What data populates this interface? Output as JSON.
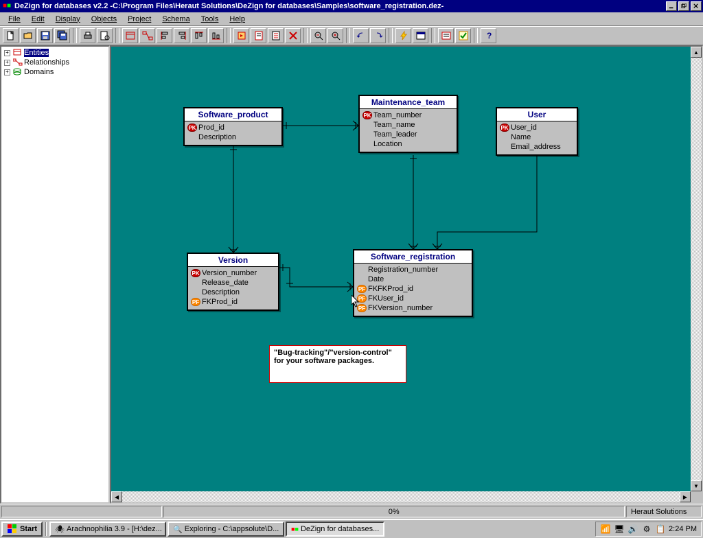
{
  "windowTitle": "DeZign for databases v2.2 -C:\\Program Files\\Heraut Solutions\\DeZign for databases\\Samples\\software_registration.dez-",
  "menus": [
    "File",
    "Edit",
    "Display",
    "Objects",
    "Project",
    "Schema",
    "Tools",
    "Help"
  ],
  "tree": {
    "items": [
      {
        "label": "Entities",
        "selected": true
      },
      {
        "label": "Relationships",
        "selected": false
      },
      {
        "label": "Domains",
        "selected": false
      }
    ]
  },
  "entities": {
    "software_product": {
      "title": "Software_product",
      "fields": [
        {
          "key": "pk",
          "keyLabel": "PK",
          "name": "Prod_id"
        },
        {
          "key": "none",
          "keyLabel": "",
          "name": "Description"
        }
      ]
    },
    "maintenance_team": {
      "title": "Maintenance_team",
      "fields": [
        {
          "key": "pk",
          "keyLabel": "PK",
          "name": "Team_number"
        },
        {
          "key": "none",
          "keyLabel": "",
          "name": "Team_name"
        },
        {
          "key": "none",
          "keyLabel": "",
          "name": "Team_leader"
        },
        {
          "key": "none",
          "keyLabel": "",
          "name": "Location"
        }
      ]
    },
    "user": {
      "title": "User",
      "fields": [
        {
          "key": "pk",
          "keyLabel": "PK",
          "name": "User_id"
        },
        {
          "key": "none",
          "keyLabel": "",
          "name": "Name"
        },
        {
          "key": "none",
          "keyLabel": "",
          "name": "Email_address"
        }
      ]
    },
    "version": {
      "title": "Version",
      "fields": [
        {
          "key": "pk",
          "keyLabel": "PK",
          "name": "Version_number"
        },
        {
          "key": "none",
          "keyLabel": "",
          "name": "Release_date"
        },
        {
          "key": "none",
          "keyLabel": "",
          "name": "Description"
        },
        {
          "key": "pf",
          "keyLabel": "PF",
          "name": "FKProd_id"
        }
      ]
    },
    "software_registration": {
      "title": "Software_registration",
      "fields": [
        {
          "key": "none",
          "keyLabel": "",
          "name": "Registration_number"
        },
        {
          "key": "none",
          "keyLabel": "",
          "name": "Date"
        },
        {
          "key": "pf",
          "keyLabel": "PF",
          "name": "FKFKProd_id"
        },
        {
          "key": "pf",
          "keyLabel": "PF",
          "name": "FKUser_id"
        },
        {
          "key": "pf",
          "keyLabel": "PF",
          "name": "FKVersion_number"
        }
      ]
    }
  },
  "note": "\"Bug-tracking\"/\"version-control\" for your software packages.",
  "status": {
    "progress": "0%",
    "company": "Heraut Solutions"
  },
  "taskbar": {
    "start": "Start",
    "tasks": [
      {
        "label": "Arachnophilia 3.9 - [H:\\dez...",
        "active": false
      },
      {
        "label": "Exploring - C:\\appsolute\\D...",
        "active": false
      },
      {
        "label": "DeZign for databases...",
        "active": true
      }
    ],
    "clock": "2:24 PM"
  },
  "chart_data": {
    "type": "diagram",
    "diagram_kind": "entity-relationship",
    "title": "software_registration",
    "entities": [
      {
        "name": "Software_product",
        "attributes": [
          {
            "name": "Prod_id",
            "key": "PK"
          },
          {
            "name": "Description",
            "key": null
          }
        ]
      },
      {
        "name": "Maintenance_team",
        "attributes": [
          {
            "name": "Team_number",
            "key": "PK"
          },
          {
            "name": "Team_name",
            "key": null
          },
          {
            "name": "Team_leader",
            "key": null
          },
          {
            "name": "Location",
            "key": null
          }
        ]
      },
      {
        "name": "User",
        "attributes": [
          {
            "name": "User_id",
            "key": "PK"
          },
          {
            "name": "Name",
            "key": null
          },
          {
            "name": "Email_address",
            "key": null
          }
        ]
      },
      {
        "name": "Version",
        "attributes": [
          {
            "name": "Version_number",
            "key": "PK"
          },
          {
            "name": "Release_date",
            "key": null
          },
          {
            "name": "Description",
            "key": null
          },
          {
            "name": "FKProd_id",
            "key": "PF"
          }
        ]
      },
      {
        "name": "Software_registration",
        "attributes": [
          {
            "name": "Registration_number",
            "key": null
          },
          {
            "name": "Date",
            "key": null
          },
          {
            "name": "FKFKProd_id",
            "key": "PF"
          },
          {
            "name": "FKUser_id",
            "key": "PF"
          },
          {
            "name": "FKVersion_number",
            "key": "PF"
          }
        ]
      }
    ],
    "relationships": [
      {
        "from": "Software_product",
        "to": "Maintenance_team",
        "from_card": "1",
        "to_card": "many"
      },
      {
        "from": "Software_product",
        "to": "Version",
        "from_card": "1",
        "to_card": "many"
      },
      {
        "from": "Version",
        "to": "Software_registration",
        "from_card": "1",
        "to_card": "many"
      },
      {
        "from": "User",
        "to": "Software_registration",
        "from_card": "1",
        "to_card": "many"
      },
      {
        "from": "Maintenance_team",
        "to": "Software_registration",
        "from_card": "1",
        "to_card": "many"
      }
    ],
    "annotation": "\"Bug-tracking\"/\"version-control\" for your software packages."
  }
}
